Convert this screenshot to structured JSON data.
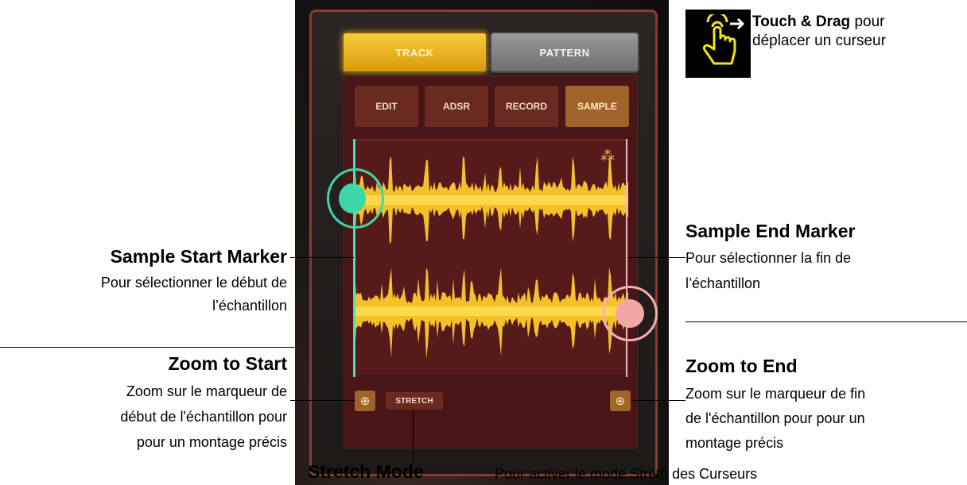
{
  "device": {
    "tabs": [
      "TRACK",
      "PATTERN"
    ],
    "subtabs": [
      "EDIT",
      "ADSR",
      "RECORD",
      "SAMPLE"
    ],
    "stretch_label": "STRETCH",
    "zoom_symbol": "⊕",
    "accent": "#f3c22b",
    "start_marker_color": "#3dd7a8",
    "end_marker_color": "#f3a6a6"
  },
  "touch": {
    "title": "Touch & Drag",
    "text1": "pour",
    "text2": "déplacer un curseur",
    "icon": "touch-drag-icon"
  },
  "sample_start": {
    "title": "Sample Start Marker",
    "line1": "Pour sélectionner le début de",
    "line2": "l’échantillon"
  },
  "sample_end": {
    "title": "Sample End Marker",
    "line1": "Pour sélectionner la fin de",
    "line2": "l’échantillon"
  },
  "zoom_start": {
    "title": "Zoom to Start",
    "line1": "Zoom sur le marqueur  de",
    "line2": "début de l'échantillon pour",
    "line3": "pour un montage précis"
  },
  "zoom_end": {
    "title": "Zoom to End",
    "line1": "Zoom sur le marqueur  de fin",
    "line2": "de l'échantillon pour pour un",
    "line3": "montage précis"
  },
  "stretch": {
    "title": "Stretch Mode",
    "desc": "Pour activer le mode Streth des Curseurs"
  }
}
